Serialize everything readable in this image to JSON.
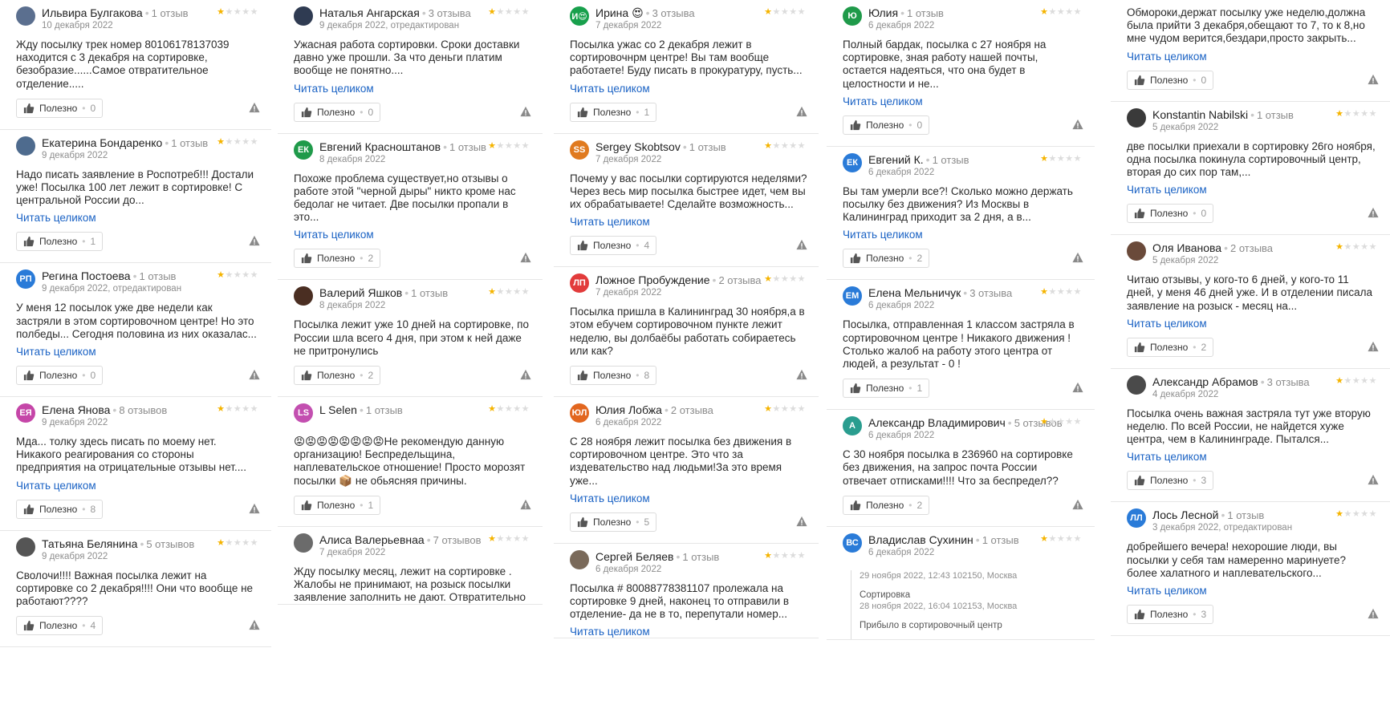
{
  "ui": {
    "read_more": "Читать целиком",
    "useful": "Полезно"
  },
  "columns": [
    [
      {
        "name": "Ильвира Булгакова",
        "count": "1 отзыв",
        "date": "10 декабря 2022",
        "stars": 1,
        "avatar": {
          "type": "photo",
          "color": "#5b6f8f",
          "letters": ""
        },
        "text": "Жду посылку трек номер 80106178137039 находится с 3 декабря на сортировке, безобразие......Самое отвратительное отделение.....",
        "more": false,
        "useful": "0"
      },
      {
        "name": "Екатерина Бондаренко",
        "count": "1 отзыв",
        "date": "9 декабря 2022",
        "stars": 1,
        "avatar": {
          "type": "photo",
          "color": "#4e6b8e",
          "letters": ""
        },
        "text": "Надо писать заявление в Роспотреб!!! Достали уже! Посылка 100 лет лежит в сортировке! С центральной России до...",
        "more": true,
        "useful": "1"
      },
      {
        "name": "Регина Постоева",
        "count": "1 отзыв",
        "date": "9 декабря 2022, отредактирован",
        "stars": 1,
        "avatar": {
          "type": "letters",
          "color": "#2a7bd8",
          "letters": "РП"
        },
        "text": "У меня 12 посылок уже две недели как застряли в этом сортировочном центре! Но это полбеды... Сегодня половина из них оказалас...",
        "more": true,
        "useful": "0"
      },
      {
        "name": "Елена Янова",
        "count": "8 отзывов",
        "date": "9 декабря 2022",
        "stars": 1,
        "avatar": {
          "type": "letters",
          "color": "#c546a8",
          "letters": "ЕЯ"
        },
        "text": "Мда... толку здесь писать по моему нет. Никакого реагирования со стороны предприятия на отрицательные отзывы нет....",
        "more": true,
        "useful": "8"
      },
      {
        "name": "Татьяна Белянина",
        "count": "5 отзывов",
        "date": "9 декабря 2022",
        "stars": 1,
        "avatar": {
          "type": "photo",
          "color": "#555555",
          "letters": ""
        },
        "text": "Сволочи!!!! Важная посылка лежит на сортировке со 2 декабря!!!! Они что вообще не работают????",
        "more": false,
        "useful": "4"
      }
    ],
    [
      {
        "name": "Наталья Ангарская",
        "count": "3 отзыва",
        "date": "9 декабря 2022, отредактирован",
        "stars": 1,
        "avatar": {
          "type": "photo",
          "color": "#2f3b52",
          "letters": ""
        },
        "text": "Ужасная работа сортировки. Сроки доставки давно уже прошли. За что деньги платим вообще не понятно....",
        "more": true,
        "useful": "0"
      },
      {
        "name": "Евгений Красноштанов",
        "count": "1 отзыв",
        "date": "8 декабря 2022",
        "stars": 1,
        "avatar": {
          "type": "letters",
          "color": "#1f9a4a",
          "letters": "ЕК"
        },
        "text": "Похоже проблема существует,но отзывы о работе этой \"черной дыры\" никто кроме нас бедолаг не читает. Две посылки пропали в это...",
        "more": true,
        "useful": "2"
      },
      {
        "name": "Валерий Яшков",
        "count": "1 отзыв",
        "date": "8 декабря 2022",
        "stars": 1,
        "avatar": {
          "type": "photo",
          "color": "#4a2e22",
          "letters": ""
        },
        "text": "Посылка лежит уже 10 дней на сортировке, по России шла всего 4 дня, при этом к ней даже не притронулись",
        "more": false,
        "useful": "2"
      },
      {
        "name": "L Selen",
        "count": "1 отзыв",
        "date": "",
        "stars": 1,
        "avatar": {
          "type": "letters",
          "color": "#c34fb0",
          "letters": "LS"
        },
        "text": "😡😡😡😡😡😡😡😡Не рекомендую данную организацию! Беспредельщина, наплевательское отношение! Просто морозят посылки 📦 не обьясняя причины.",
        "more": false,
        "useful": "1"
      },
      {
        "name": "Алиса Валерьевнаа",
        "count": "7 отзывов",
        "date": "7 декабря 2022",
        "stars": 1,
        "avatar": {
          "type": "photo",
          "color": "#6b6b6b",
          "letters": ""
        },
        "text": "Жду посылку месяц, лежит на сортировке . Жалобы не принимают, на розыск посылки заявление заполнить не дают. Отвратительно",
        "more": false,
        "useful": ""
      }
    ],
    [
      {
        "name": "Ирина 😍",
        "count": "3 отзыва",
        "date": "7 декабря 2022",
        "stars": 1,
        "avatar": {
          "type": "letters",
          "color": "#18a04c",
          "letters": "И😍"
        },
        "text": "Посылка ужас со 2 декабря лежит в сортировочнрм центре! Вы там вообще работаете! Буду писать в прокуратуру, пусть...",
        "more": true,
        "useful": "1"
      },
      {
        "name": "Sergey Skobtsov",
        "count": "1 отзыв",
        "date": "7 декабря 2022",
        "stars": 1,
        "avatar": {
          "type": "letters",
          "color": "#e07a1f",
          "letters": "SS"
        },
        "text": "Почему у вас посылки сортируются неделями? Через весь мир посылка быстрее идет, чем вы их обрабатываете! Сделайте возможность...",
        "more": true,
        "useful": "4"
      },
      {
        "name": "Ложное Пробуждение",
        "count": "2 отзыва",
        "date": "7 декабря 2022",
        "stars": 1,
        "avatar": {
          "type": "letters",
          "color": "#e23b3b",
          "letters": "ЛП"
        },
        "text": "Посылка пришла в Калининград 30 ноября,а в этом ебучем сортировочном пункте лежит неделю, вы долбаёбы работать собираетесь или как?",
        "more": false,
        "useful": "8"
      },
      {
        "name": "Юлия Лобжа",
        "count": "2 отзыва",
        "date": "6 декабря 2022",
        "stars": 1,
        "avatar": {
          "type": "letters",
          "color": "#e2661f",
          "letters": "ЮЛ"
        },
        "text": "С 28 ноября лежит посылка без движения в сортировочном центре. Это что за издевательство над людьми!За это время уже...",
        "more": true,
        "useful": "5"
      },
      {
        "name": "Сергей Беляев",
        "count": "1 отзыв",
        "date": "6 декабря 2022",
        "stars": 1,
        "avatar": {
          "type": "photo",
          "color": "#7a6a5a",
          "letters": ""
        },
        "text": "Посылка # 80088778381107 пролежала на сортировке 9 дней, наконец то отправили в отделение- да не в то, перепутали номер...",
        "more": true,
        "useful": ""
      }
    ],
    [
      {
        "name": "Юлия",
        "count": "1 отзыв",
        "date": "6 декабря 2022",
        "stars": 1,
        "avatar": {
          "type": "letters",
          "color": "#1f9a4a",
          "letters": "Ю"
        },
        "text": "Полный бардак, посылка с 27 ноября на сортировке, зная работу нашей почты, остается надеяться, что она будет в целостности и не...",
        "more": true,
        "useful": "0"
      },
      {
        "name": "Евгений К.",
        "count": "1 отзыв",
        "date": "6 декабря 2022",
        "stars": 1,
        "avatar": {
          "type": "letters",
          "color": "#2a7bd8",
          "letters": "ЕК"
        },
        "text": "Вы там умерли все?! Сколько можно держать посылку без движения? Из Москвы в Калининград приходит за 2 дня, а в...",
        "more": true,
        "useful": "2"
      },
      {
        "name": "Елена Мельничук",
        "count": "3 отзыва",
        "date": "6 декабря 2022",
        "stars": 1,
        "avatar": {
          "type": "letters",
          "color": "#2a7bd8",
          "letters": "ЕМ"
        },
        "text": "Посылка, отправленная 1 классом застряла в сортировочном центре ! Никакого движения ! Столько жалоб на работу этого центра от людей, а результат - 0 !",
        "more": false,
        "useful": "1"
      },
      {
        "name": "Александр Владимирович",
        "count": "5 отзывов",
        "date": "6 декабря 2022",
        "stars": 1,
        "avatar": {
          "type": "letters",
          "color": "#2a9d8f",
          "letters": "А"
        },
        "text": "С 30 ноября посылка в 236960 на сортировке без движения, на запрос почта России отвечает отписками!!!! Что за беспредел??",
        "more": false,
        "useful": "2"
      },
      {
        "name": "Владислав Сухинин",
        "count": "1 отзыв",
        "date": "6 декабря 2022",
        "stars": 1,
        "avatar": {
          "type": "letters",
          "color": "#2a7bd8",
          "letters": "ВС"
        },
        "text": "",
        "more": false,
        "useful": "",
        "track": [
          {
            "title": "",
            "date": "29 ноября 2022, 12:43 102150, Москва"
          },
          {
            "title": "Сортировка",
            "date": "28 ноября 2022, 16:04 102153, Москва"
          },
          {
            "title": "Прибыло в сортировочный центр",
            "date": ""
          }
        ]
      }
    ],
    [
      {
        "name": "",
        "count": "",
        "date": "",
        "stars": 0,
        "avatar": {
          "type": "none",
          "color": "",
          "letters": ""
        },
        "text": "Обмороки,держат посылку уже неделю,должна была прийти 3 декабря,обещают то 7, то к 8,но мне чудом верится,бездари,просто закрыть...",
        "more": true,
        "useful": "0"
      },
      {
        "name": "Konstantin Nabilski",
        "count": "1 отзыв",
        "date": "5 декабря 2022",
        "stars": 1,
        "avatar": {
          "type": "photo",
          "color": "#3a3a3a",
          "letters": ""
        },
        "text": "две посылки приехали в сортировку 26го ноября, одна посылка покинула сортировочный центр, вторая до сих пор там,...",
        "more": true,
        "useful": "0"
      },
      {
        "name": "Оля Иванова",
        "count": "2 отзыва",
        "date": "5 декабря 2022",
        "stars": 1,
        "avatar": {
          "type": "photo",
          "color": "#6a4a3a",
          "letters": ""
        },
        "text": "Читаю отзывы, у кого-то 6 дней, у кого-то 11 дней, у меня 46 дней уже. И в отделении писала заявление на розыск - месяц на...",
        "more": true,
        "useful": "2"
      },
      {
        "name": "Александр Абрамов",
        "count": "3 отзыва",
        "date": "4 декабря 2022",
        "stars": 1,
        "avatar": {
          "type": "photo",
          "color": "#4a4a4a",
          "letters": ""
        },
        "text": "Посылка очень важная застряла тут уже вторую неделю. По всей России, не найдется хуже центра, чем в Калининграде. Пытался...",
        "more": true,
        "useful": "3"
      },
      {
        "name": "Лось Лесной",
        "count": "1 отзыв",
        "date": "3 декабря 2022, отредактирован",
        "stars": 1,
        "avatar": {
          "type": "letters",
          "color": "#2a7bd8",
          "letters": "ЛЛ"
        },
        "text": "добрейшего вечера! нехорошие люди, вы посылки у себя там намеренно маринуете? более халатного и наплевательского...",
        "more": true,
        "useful": "3"
      }
    ]
  ]
}
